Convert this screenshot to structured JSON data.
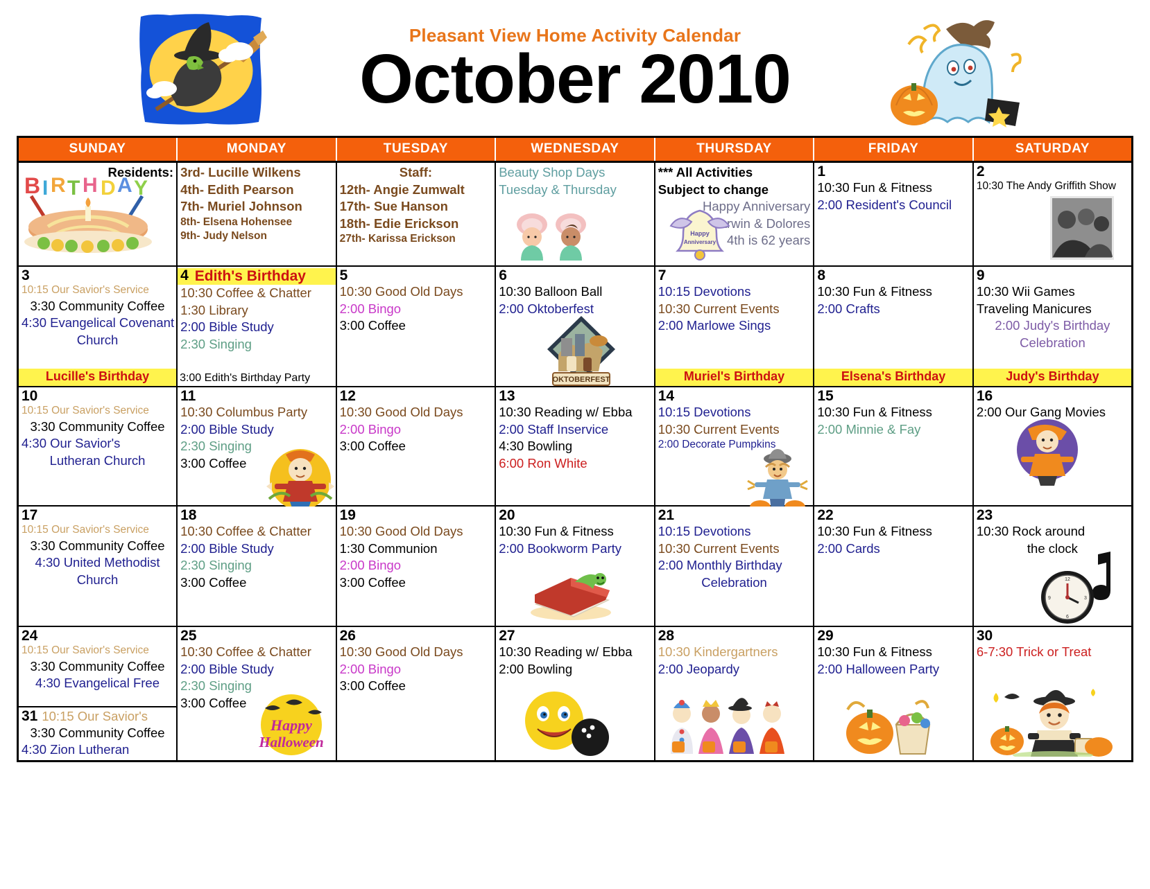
{
  "header": {
    "subtitle": "Pleasant View Home Activity Calendar",
    "month_title": "October 2010",
    "left_art": "witch-on-broom-icon",
    "right_art": "ghost-with-pumpkin-icon"
  },
  "accent_colors": {
    "header_bar": "#F4600C",
    "subtitle": "#E8751A",
    "birthday_banner_bg": "#FFF34D",
    "birthday_banner_text": "#CC1111"
  },
  "weekdays": [
    "SUNDAY",
    "MONDAY",
    "TUESDAY",
    "WEDNESDAY",
    "THURSDAY",
    "FRIDAY",
    "SATURDAY"
  ],
  "cells": {
    "r1c1": {
      "art": "birthday-cake-icon",
      "lines": [
        {
          "text": "Residents:",
          "color": "black",
          "bold": true,
          "align": "right"
        }
      ]
    },
    "r1c2": {
      "lines": [
        {
          "text": "3rd- Lucille Wilkens",
          "color": "brown",
          "bold": true
        },
        {
          "text": "4th- Edith Pearson",
          "color": "brown",
          "bold": true
        },
        {
          "text": "7th- Muriel Johnson",
          "color": "brown",
          "bold": true
        },
        {
          "text": "8th- Elsena Hohensee",
          "color": "brown",
          "bold": true,
          "small": true
        },
        {
          "text": "9th- Judy Nelson",
          "color": "brown",
          "bold": true,
          "small": true
        }
      ]
    },
    "r1c3": {
      "lines": [
        {
          "text": "Staff:",
          "color": "brown",
          "bold": true,
          "align": "center"
        },
        {
          "text": "12th- Angie Zumwalt",
          "color": "brown",
          "bold": true
        },
        {
          "text": "17th- Sue Hanson",
          "color": "brown",
          "bold": true
        },
        {
          "text": "18th- Edie Erickson",
          "color": "brown",
          "bold": true
        },
        {
          "text": "27th- Karissa Erickson",
          "color": "brown",
          "bold": true,
          "small": true
        }
      ]
    },
    "r1c4": {
      "art": "beauty-salon-icon",
      "lines": [
        {
          "text": "Beauty Shop Days",
          "color": "teal"
        },
        {
          "text": "Tuesday & Thursday",
          "color": "teal"
        }
      ]
    },
    "r1c5": {
      "art": "happy-anniversary-bell-icon",
      "lines": [
        {
          "text": "*** All Activities",
          "color": "black",
          "bold": true
        },
        {
          "text": "Subject to change",
          "color": "black",
          "bold": true
        },
        {
          "text": "Happy Anniversary",
          "color": "gray",
          "align": "right"
        },
        {
          "text": "Darwin & Dolores",
          "color": "gray",
          "align": "right"
        },
        {
          "text": "4th is 62 years",
          "color": "gray",
          "align": "right"
        }
      ]
    },
    "r1c6": {
      "day": "1",
      "lines": [
        {
          "text": "10:30 Fun & Fitness",
          "color": "black"
        },
        {
          "text": "2:00 Resident's Council",
          "color": "navy"
        }
      ]
    },
    "r1c7": {
      "day": "2",
      "art": "andy-griffith-photo-icon",
      "lines": [
        {
          "text": "10:30 The Andy Griffith Show",
          "color": "black",
          "small": true
        }
      ]
    },
    "r2c1": {
      "day": "3",
      "lines": [
        {
          "text": "10:15 Our Savior's Service",
          "color": "tan",
          "small": true
        },
        {
          "text": "3:30 Community Coffee",
          "color": "black",
          "align": "center"
        },
        {
          "text": "4:30 Evangelical Covenant",
          "color": "navy",
          "align": "center"
        },
        {
          "text": "Church",
          "color": "navy",
          "align": "center"
        }
      ],
      "banner": {
        "text": "Lucille's Birthday",
        "style": "birthday"
      }
    },
    "r2c2": {
      "day": "4",
      "title": "Edith's Birthday",
      "lines": [
        {
          "text": "10:30 Coffee & Chatter",
          "color": "brown"
        },
        {
          "text": "1:30 Library",
          "color": "brown"
        },
        {
          "text": "2:00 Bible Study",
          "color": "navy"
        },
        {
          "text": "2:30 Singing",
          "color": "green"
        }
      ],
      "banner": {
        "text": "3:00 Edith's Birthday Party",
        "style": "plain"
      }
    },
    "r2c3": {
      "day": "5",
      "lines": [
        {
          "text": "10:30 Good Old Days",
          "color": "brown"
        },
        {
          "text": "2:00 Bingo",
          "color": "magenta"
        },
        {
          "text": "3:00 Coffee",
          "color": "black"
        }
      ]
    },
    "r2c4": {
      "day": "6",
      "art": "oktoberfest-badge-icon",
      "lines": [
        {
          "text": "10:30 Balloon Ball",
          "color": "black"
        },
        {
          "text": "2:00 Oktoberfest",
          "color": "navy"
        }
      ]
    },
    "r2c5": {
      "day": "7",
      "lines": [
        {
          "text": "10:15 Devotions",
          "color": "navy"
        },
        {
          "text": "10:30 Current Events",
          "color": "brown"
        },
        {
          "text": "2:00 Marlowe Sings",
          "color": "navy"
        }
      ],
      "banner": {
        "text": "Muriel's Birthday",
        "style": "birthday"
      }
    },
    "r2c6": {
      "day": "8",
      "lines": [
        {
          "text": "10:30 Fun & Fitness",
          "color": "black"
        },
        {
          "text": "2:00 Crafts",
          "color": "navy"
        }
      ],
      "banner": {
        "text": "Elsena's Birthday",
        "style": "birthday"
      }
    },
    "r2c7": {
      "day": "9",
      "lines": [
        {
          "text": "10:30 Wii Games",
          "color": "black"
        },
        {
          "text": "Traveling Manicures",
          "color": "black"
        },
        {
          "text": "2:00 Judy's Birthday",
          "color": "purple",
          "align": "center"
        },
        {
          "text": "Celebration",
          "color": "purple",
          "align": "center"
        }
      ],
      "banner": {
        "text": "Judy's Birthday",
        "style": "birthday"
      }
    },
    "r3c1": {
      "day": "10",
      "lines": [
        {
          "text": "10:15 Our Savior's Service",
          "color": "tan",
          "small": true
        },
        {
          "text": "3:30 Community Coffee",
          "color": "black",
          "align": "center"
        },
        {
          "text": "4:30 Our Savior's",
          "color": "navy"
        },
        {
          "text": "Lutheran Church",
          "color": "navy",
          "align": "center"
        }
      ]
    },
    "r3c2": {
      "day": "11",
      "art": "scarecrow-pumpkin-icon",
      "lines": [
        {
          "text": "10:30 Columbus Party",
          "color": "brown"
        },
        {
          "text": "2:00 Bible Study",
          "color": "navy"
        },
        {
          "text": "2:30 Singing",
          "color": "green"
        },
        {
          "text": "3:00 Coffee",
          "color": "black"
        }
      ]
    },
    "r3c3": {
      "day": "12",
      "lines": [
        {
          "text": "10:30 Good Old Days",
          "color": "brown"
        },
        {
          "text": "2:00 Bingo",
          "color": "magenta"
        },
        {
          "text": "3:00 Coffee",
          "color": "black"
        }
      ]
    },
    "r3c4": {
      "day": "13",
      "lines": [
        {
          "text": "10:30 Reading w/ Ebba",
          "color": "black"
        },
        {
          "text": "2:00 Staff Inservice",
          "color": "navy"
        },
        {
          "text": "4:30 Bowling",
          "color": "black"
        },
        {
          "text": "6:00 Ron White",
          "color": "red"
        }
      ]
    },
    "r3c5": {
      "day": "14",
      "art": "scarecrow-icon",
      "lines": [
        {
          "text": "10:15 Devotions",
          "color": "navy"
        },
        {
          "text": "10:30 Current Events",
          "color": "brown"
        },
        {
          "text": "2:00 Decorate Pumpkins",
          "color": "navy",
          "small": true
        }
      ]
    },
    "r3c6": {
      "day": "15",
      "lines": [
        {
          "text": "10:30 Fun & Fitness",
          "color": "black"
        },
        {
          "text": "2:00 Minnie & Fay",
          "color": "green"
        }
      ]
    },
    "r3c7": {
      "day": "16",
      "art": "halloween-character-icon",
      "lines": [
        {
          "text": "2:00 Our Gang Movies",
          "color": "black"
        }
      ]
    },
    "r4c1": {
      "day": "17",
      "lines": [
        {
          "text": "10:15 Our Savior's Service",
          "color": "tan",
          "small": true
        },
        {
          "text": "3:30 Community Coffee",
          "color": "black",
          "align": "center"
        },
        {
          "text": "4:30 United Methodist",
          "color": "navy",
          "align": "center"
        },
        {
          "text": "Church",
          "color": "navy",
          "align": "center"
        }
      ]
    },
    "r4c2": {
      "day": "18",
      "lines": [
        {
          "text": "10:30 Coffee & Chatter",
          "color": "brown"
        },
        {
          "text": "2:00 Bible Study",
          "color": "navy"
        },
        {
          "text": "2:30 Singing",
          "color": "green"
        },
        {
          "text": "3:00 Coffee",
          "color": "black"
        }
      ]
    },
    "r4c3": {
      "day": "19",
      "lines": [
        {
          "text": "10:30 Good Old Days",
          "color": "brown"
        },
        {
          "text": "1:30 Communion",
          "color": "black"
        },
        {
          "text": "2:00 Bingo",
          "color": "magenta"
        },
        {
          "text": "3:00 Coffee",
          "color": "black"
        }
      ]
    },
    "r4c4": {
      "day": "20",
      "art": "bookworm-icon",
      "lines": [
        {
          "text": "10:30 Fun & Fitness",
          "color": "black"
        },
        {
          "text": "2:00 Bookworm Party",
          "color": "navy"
        }
      ]
    },
    "r4c5": {
      "day": "21",
      "lines": [
        {
          "text": "10:15 Devotions",
          "color": "navy"
        },
        {
          "text": "10:30 Current Events",
          "color": "brown"
        },
        {
          "text": "2:00 Monthly Birthday",
          "color": "navy"
        },
        {
          "text": "Celebration",
          "color": "navy",
          "align": "center"
        }
      ]
    },
    "r4c6": {
      "day": "22",
      "lines": [
        {
          "text": "10:30 Fun & Fitness",
          "color": "black"
        },
        {
          "text": "2:00 Cards",
          "color": "navy"
        }
      ]
    },
    "r4c7": {
      "day": "23",
      "art": "clock-music-note-icon",
      "lines": [
        {
          "text": "10:30 Rock around",
          "color": "black"
        },
        {
          "text": "the clock",
          "color": "black",
          "align": "center"
        }
      ]
    },
    "r5c1": {
      "day": "24",
      "lines": [
        {
          "text": "10:15 Our Savior's Service",
          "color": "tan",
          "small": true
        },
        {
          "text": "3:30 Community Coffee",
          "color": "black",
          "align": "center"
        },
        {
          "text": "4:30 Evangelical Free",
          "color": "navy",
          "align": "center"
        }
      ],
      "sub_day": {
        "day": "31",
        "first_line": "10:15 Our Savior's",
        "first_line_color": "tan",
        "lines": [
          {
            "text": "3:30 Community Coffee",
            "color": "black",
            "align": "center"
          },
          {
            "text": "4:30 Zion Lutheran",
            "color": "navy"
          }
        ]
      }
    },
    "r5c2": {
      "day": "25",
      "art": "happy-halloween-moon-icon",
      "lines": [
        {
          "text": "10:30 Coffee & Chatter",
          "color": "brown"
        },
        {
          "text": "2:00 Bible Study",
          "color": "navy"
        },
        {
          "text": "2:30 Singing",
          "color": "green"
        },
        {
          "text": "3:00 Coffee",
          "color": "black"
        }
      ]
    },
    "r5c3": {
      "day": "26",
      "lines": [
        {
          "text": "10:30 Good Old Days",
          "color": "brown"
        },
        {
          "text": "2:00 Bingo",
          "color": "magenta"
        },
        {
          "text": "3:00 Coffee",
          "color": "black"
        }
      ]
    },
    "r5c4": {
      "day": "27",
      "art": "bowling-smiley-icon",
      "lines": [
        {
          "text": "10:30 Reading w/ Ebba",
          "color": "black"
        },
        {
          "text": "2:00 Bowling",
          "color": "black"
        }
      ]
    },
    "r5c5": {
      "day": "28",
      "art": "trick-or-treat-kids-icon",
      "lines": [
        {
          "text": "10:30 Kindergartners",
          "color": "tan"
        },
        {
          "text": "2:00 Jeopardy",
          "color": "navy"
        }
      ]
    },
    "r5c6": {
      "day": "29",
      "art": "pumpkin-basket-icon",
      "lines": [
        {
          "text": "10:30 Fun & Fitness",
          "color": "black"
        },
        {
          "text": "2:00 Halloween Party",
          "color": "navy"
        }
      ]
    },
    "r5c7": {
      "day": "30",
      "art": "witch-girl-pumpkin-icon",
      "lines": [
        {
          "text": "6-7:30 Trick or Treat",
          "color": "red"
        }
      ]
    }
  }
}
